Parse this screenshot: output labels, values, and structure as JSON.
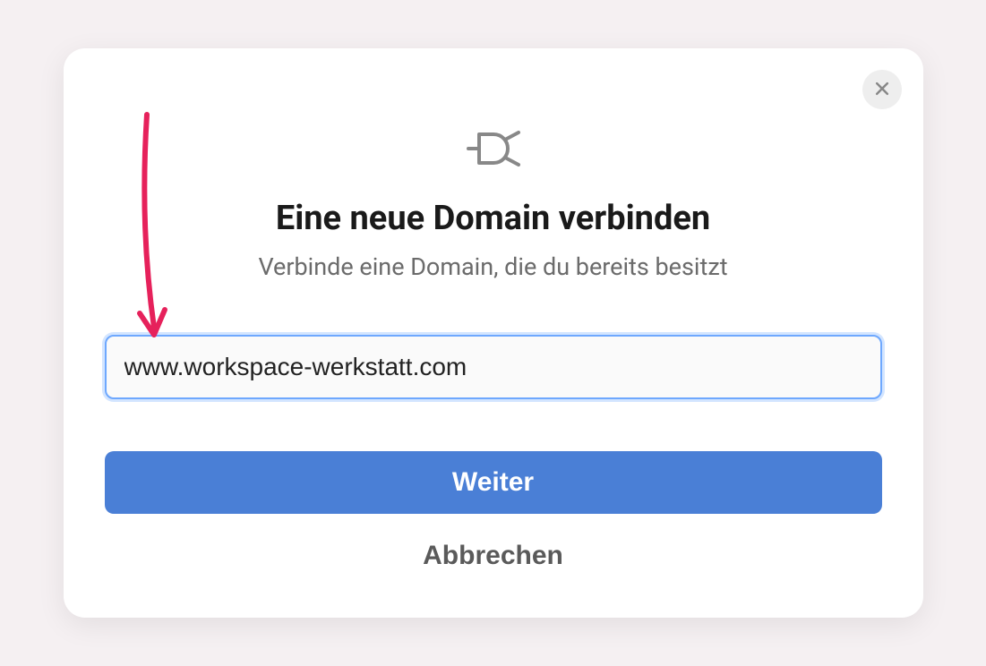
{
  "modal": {
    "title": "Eine neue Domain verbinden",
    "subtitle": "Verbinde eine Domain, die du bereits besitzt",
    "domain_value": "www.workspace-werkstatt.com",
    "primary_button": "Weiter",
    "secondary_button": "Abbrechen"
  },
  "colors": {
    "primary": "#4a7fd6",
    "accent_arrow": "#e91e63"
  }
}
